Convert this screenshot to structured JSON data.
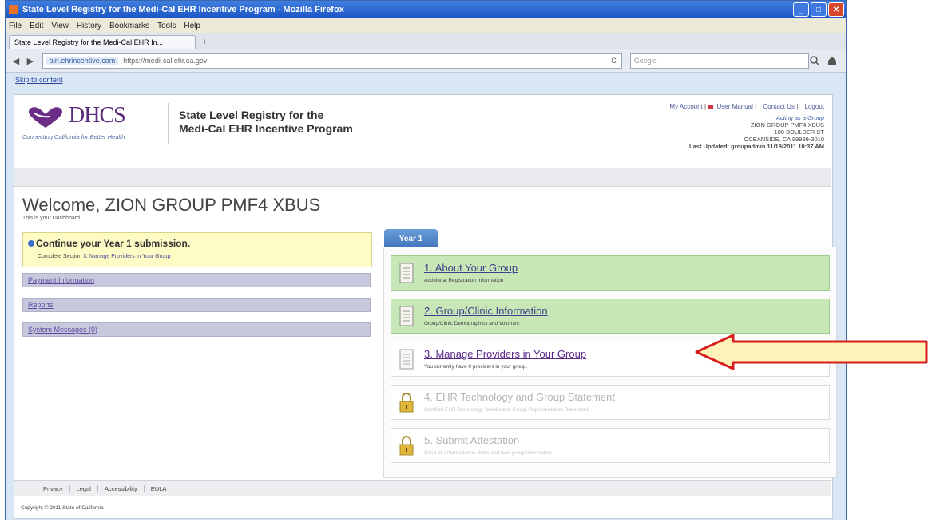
{
  "window": {
    "title": "State Level Registry for the Medi-Cal EHR Incentive Program - Mozilla Firefox",
    "controls": [
      "_",
      "□",
      "✕"
    ]
  },
  "menu": [
    "File",
    "Edit",
    "View",
    "History",
    "Bookmarks",
    "Tools",
    "Help"
  ],
  "tab": {
    "label": "State Level Registry for the Medi-Cal EHR In...",
    "new_tab": "+"
  },
  "nav": {
    "back": "◀",
    "forward": "▶",
    "url_domain": "ain.ehrincentive.com",
    "url": "https://medi-cal.ehr.ca.gov",
    "reload": "C",
    "search_placeholder": "Google",
    "search_icon": "search-icon",
    "home_icon": "home-icon"
  },
  "skip_link": "Skip to content",
  "header": {
    "logo_text": "DHCS",
    "logo_tagline": "Connecting California for Better Health",
    "title_line1": "State Level Registry for the",
    "title_line2": "Medi-Cal EHR Incentive Program",
    "links": [
      "My Account",
      "User Manual",
      "Contact Us",
      "Logout"
    ],
    "acting_as": "Acting as a Group",
    "group_name": "ZION GROUP PMF4 XBUS",
    "address_line1": "100 BOULDER ST",
    "address_line2": "OCEANSIDE, CA 99999-3010",
    "last_updated": "Last Updated: groupadmin 11/18/2011 10:37 AM"
  },
  "welcome": {
    "heading": "Welcome, ZION GROUP PMF4 XBUS",
    "subtext": "This is your Dashboard."
  },
  "continue_box": {
    "heading": "Continue your Year 1 submission.",
    "prefix": "Complete Section",
    "link": "3. Manage Providers in Your Group"
  },
  "left_links": [
    "Payment Information",
    "Reports",
    "System Messages (0)"
  ],
  "year_tab": "Year 1",
  "steps": [
    {
      "title": "1. About Your Group",
      "desc": "Additional Registration Information",
      "state": "done"
    },
    {
      "title": "2. Group/Clinic Information",
      "desc": "Group/Clinic Demographics and Volumes",
      "state": "done"
    },
    {
      "title": "3. Manage Providers in Your Group",
      "desc": "You currently have 0 providers in your group.",
      "state": "active"
    },
    {
      "title": "4. EHR Technology and Group Statement",
      "desc": "Certified EHR Technology Details and Group Representative Statement",
      "state": "locked"
    },
    {
      "title": "5. Submit Attestation",
      "desc": "Send all information to State and lock group information",
      "state": "locked"
    }
  ],
  "footer_links": [
    "Privacy",
    "Legal",
    "Accessibility",
    "EULA"
  ],
  "copyright": "Copyright © 2011 State of California",
  "colors": {
    "title_bar": "#1d55c4",
    "step_done": "#c7e7b6",
    "continue_bg": "#fffbc4",
    "arrow_fill": "#fff2b8",
    "arrow_stroke": "#d81d1d"
  }
}
